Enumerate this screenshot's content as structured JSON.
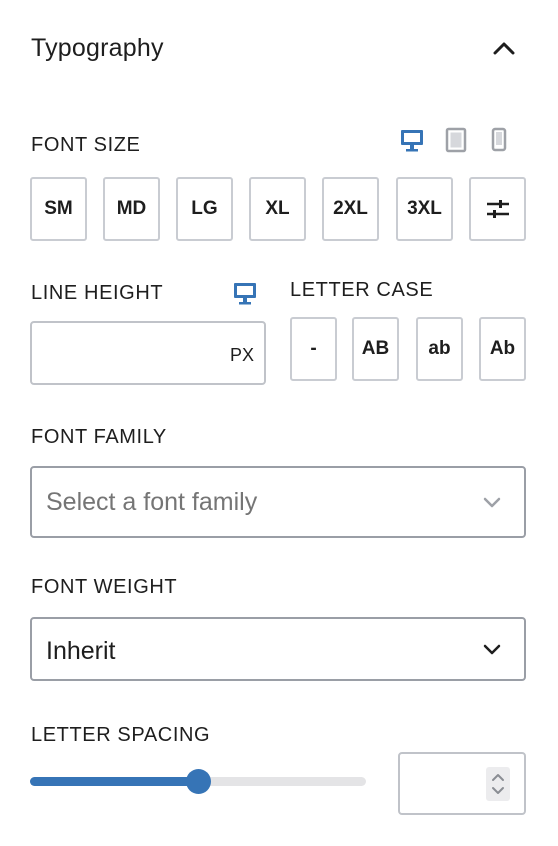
{
  "panel": {
    "title": "Typography"
  },
  "font_size": {
    "label": "FONT SIZE",
    "presets": [
      "SM",
      "MD",
      "LG",
      "XL",
      "2XL",
      "3XL"
    ],
    "device_icons": [
      "desktop-icon",
      "tablet-icon",
      "mobile-icon"
    ],
    "active_device": "desktop"
  },
  "line_height": {
    "label": "LINE HEIGHT",
    "value": "",
    "unit": "PX"
  },
  "letter_case": {
    "label": "LETTER CASE",
    "options": [
      "-",
      "AB",
      "ab",
      "Ab"
    ]
  },
  "font_family": {
    "label": "FONT FAMILY",
    "placeholder": "Select a font family"
  },
  "font_weight": {
    "label": "FONT WEIGHT",
    "value": "Inherit"
  },
  "letter_spacing": {
    "label": "LETTER SPACING",
    "value": "",
    "slider_fraction": 0.5
  },
  "colors": {
    "accent": "#3674b6",
    "inactive_icon": "#9ea1a7",
    "border": "#c9ccd2"
  }
}
